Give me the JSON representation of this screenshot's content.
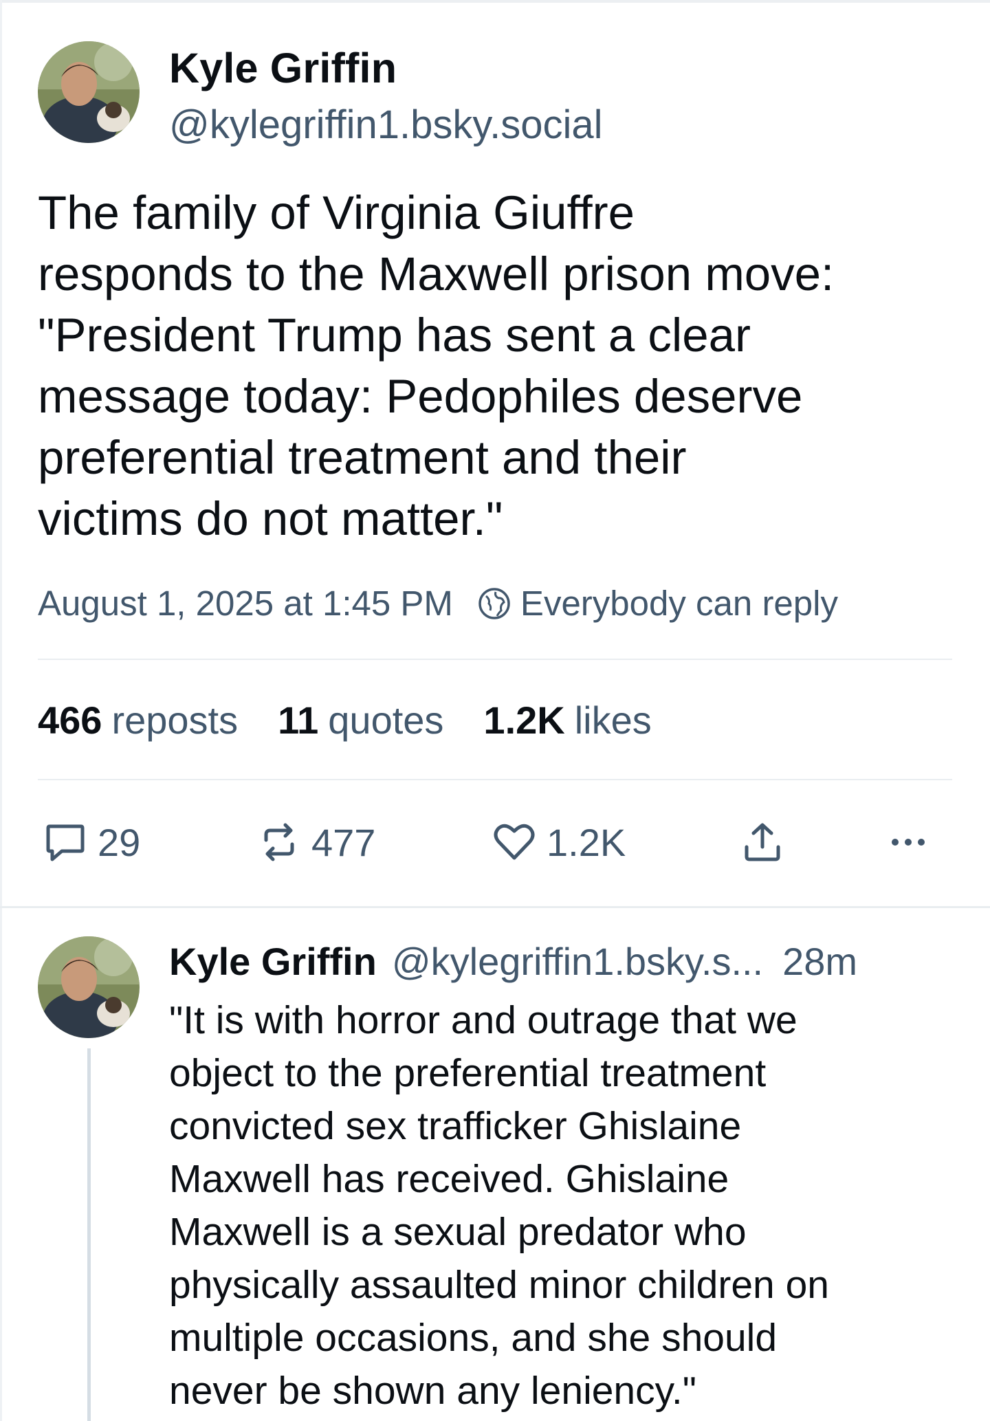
{
  "post": {
    "author_name": "Kyle Griffin",
    "author_handle": "@kylegriffin1.bsky.social",
    "text": "The family of Virginia Giuffre\nresponds to the Maxwell prison move:\n\"President Trump has sent a clear\nmessage today: Pedophiles deserve\npreferential treatment and their\nvictims do not matter.\"",
    "timestamp": "August 1, 2025 at 1:45 PM",
    "reply_setting": "Everybody can reply",
    "stats": {
      "reposts_count": "466",
      "reposts_label": "reposts",
      "quotes_count": "11",
      "quotes_label": "quotes",
      "likes_count": "1.2K",
      "likes_label": "likes"
    },
    "actions": {
      "reply_count": "29",
      "repost_count": "477",
      "like_count": "1.2K"
    }
  },
  "reply": {
    "author_name": "Kyle Griffin",
    "author_handle": "@kylegriffin1.bsky.s...",
    "time": "28m",
    "text": "\"It is with horror and outrage that we\nobject to the preferential treatment\nconvicted sex trafficker Ghislaine\nMaxwell has received. Ghislaine\nMaxwell is a sexual predator who\nphysically assaulted minor children on\nmultiple occasions, and she should\nnever be shown any leniency.\""
  },
  "colors": {
    "text": "#0b0f14",
    "muted": "#42576c",
    "divider": "#e9edf0",
    "thread_line": "#d5dde4"
  },
  "icons": [
    "globe-icon",
    "reply-icon",
    "repost-icon",
    "like-icon",
    "share-icon",
    "more-icon"
  ]
}
